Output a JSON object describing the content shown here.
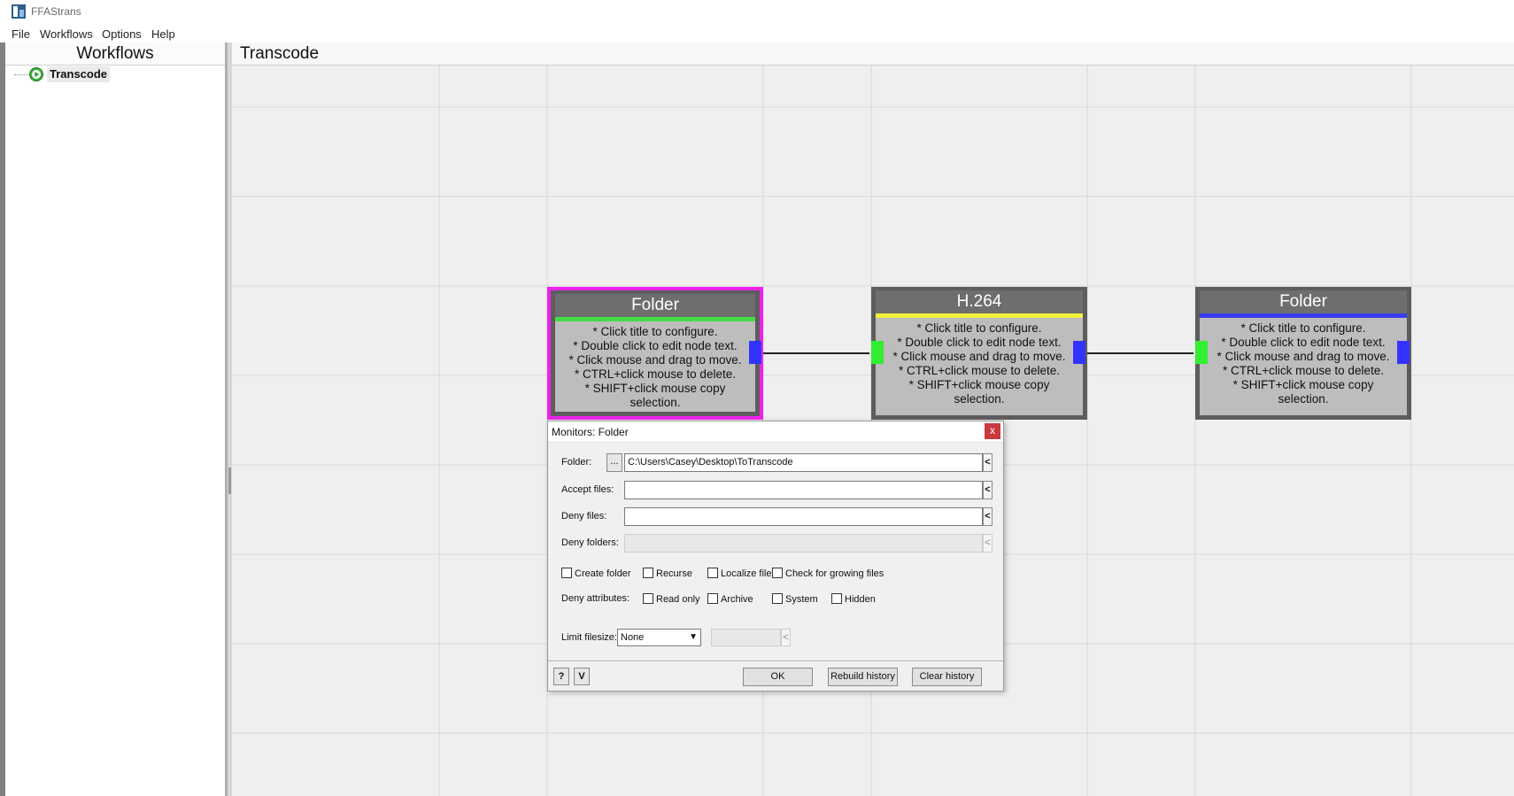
{
  "app": {
    "title": "FFAStrans"
  },
  "menu": {
    "file": "File",
    "workflows": "Workflows",
    "options": "Options",
    "help": "Help"
  },
  "left_panel": {
    "header": "Workflows",
    "tree": [
      {
        "label": "Transcode"
      }
    ]
  },
  "canvas": {
    "header": "Transcode",
    "nodes": [
      {
        "title": "Folder",
        "accent": "#44dd44",
        "selected": true,
        "body": [
          "* Click title to configure.",
          "* Double click to edit node text.",
          "* Click mouse and drag to move.",
          "* CTRL+click mouse to delete.",
          "* SHIFT+click mouse copy",
          "selection."
        ]
      },
      {
        "title": "H.264",
        "accent": "#f2f23a",
        "selected": false,
        "body": [
          "* Click title to configure.",
          "* Double click to edit node text.",
          "* Click mouse and drag to move.",
          "* CTRL+click mouse to delete.",
          "* SHIFT+click mouse copy",
          "selection."
        ]
      },
      {
        "title": "Folder",
        "accent": "#3b3bf0",
        "selected": false,
        "body": [
          "* Click title to configure.",
          "* Double click to edit node text.",
          "* Click mouse and drag to move.",
          "* CTRL+click mouse to delete.",
          "* SHIFT+click mouse copy",
          "selection."
        ]
      }
    ]
  },
  "dialog": {
    "title": "Monitors: Folder",
    "close": "x",
    "folder_label": "Folder:",
    "browse": "...",
    "folder_value": "C:\\Users\\Casey\\Desktop\\ToTranscode",
    "accept_label": "Accept files:",
    "accept_value": "",
    "deny_files_label": "Deny files:",
    "deny_files_value": "",
    "deny_folders_label": "Deny folders:",
    "deny_folders_value": "",
    "arrow": "<",
    "checkboxes": {
      "create_folder": "Create folder",
      "recurse": "Recurse",
      "localize_file": "Localize file",
      "check_growing": "Check for growing files"
    },
    "deny_attributes_label": "Deny attributes:",
    "attributes": {
      "read_only": "Read only",
      "archive": "Archive",
      "system": "System",
      "hidden": "Hidden"
    },
    "limit_filesize_label": "Limit filesize:",
    "limit_filesize_value": "None",
    "help_button": "?",
    "v_button": "V",
    "ok": "OK",
    "rebuild_history": "Rebuild history",
    "clear_history": "Clear history"
  },
  "colors": {
    "selection": "#ee22ee",
    "port_in": "#33ee33",
    "port_out": "#3333ff"
  }
}
